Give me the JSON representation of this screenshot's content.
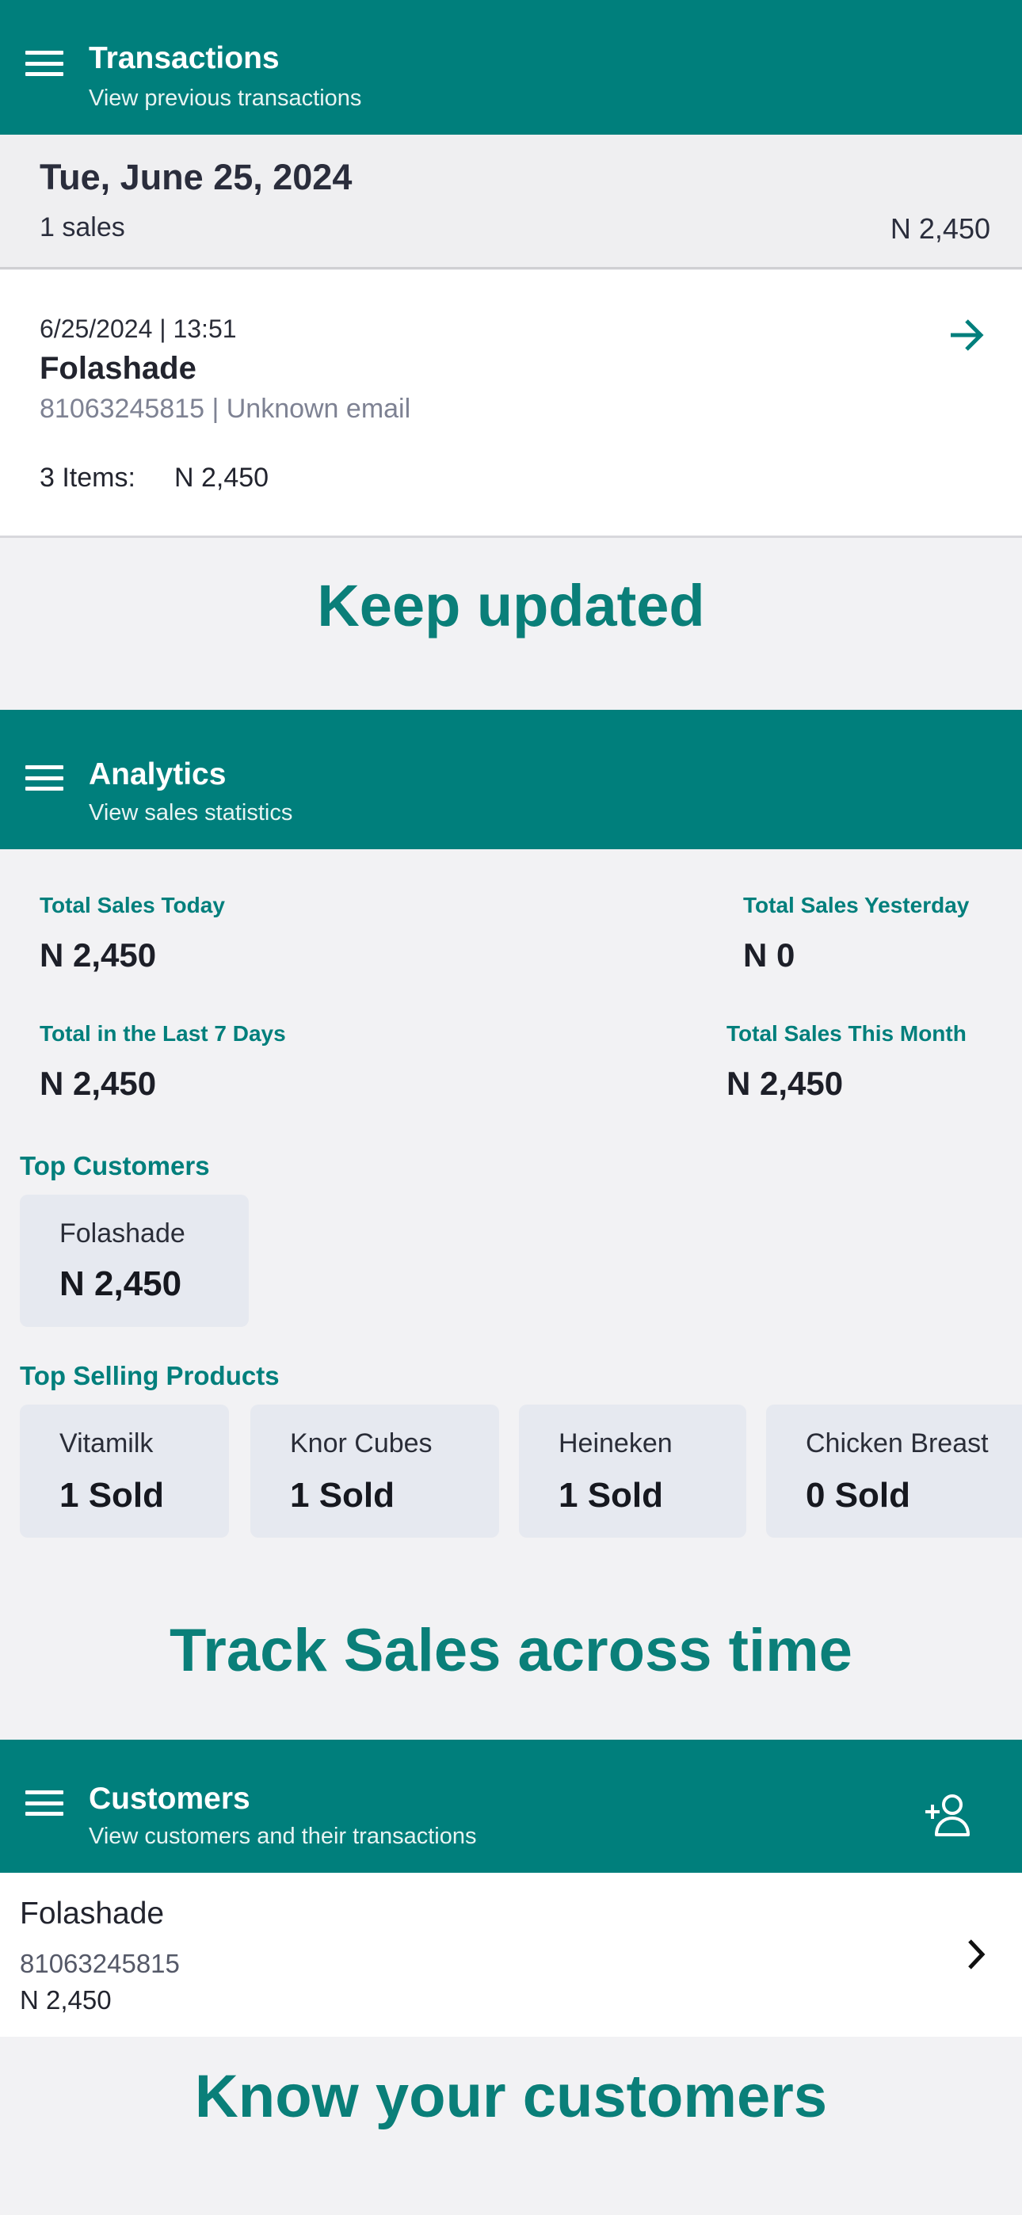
{
  "colors": {
    "accent": "#007f7c",
    "background": "#f2f2f4",
    "card": "#e6e9f0"
  },
  "transactions": {
    "header": {
      "title": "Transactions",
      "subtitle": "View previous transactions",
      "menu_icon": "hamburger-icon"
    },
    "day": {
      "date": "Tue, June 25, 2024",
      "count": "1 sales",
      "total": "N 2,450"
    },
    "items": [
      {
        "datetime": "6/25/2024 | 13:51",
        "customer": "Folashade",
        "contact": "81063245815 | Unknown email",
        "items_label": "3 Items:",
        "amount": "N 2,450",
        "icon": "arrow-right-icon"
      }
    ],
    "tagline": "Keep updated"
  },
  "analytics": {
    "header": {
      "title": "Analytics",
      "subtitle": "View sales statistics",
      "menu_icon": "hamburger-icon"
    },
    "stats": [
      {
        "label": "Total Sales Today",
        "value": "N 2,450"
      },
      {
        "label": "Total Sales Yesterday",
        "value": "N 0"
      },
      {
        "label": "Total in the Last 7 Days",
        "value": "N 2,450"
      },
      {
        "label": "Total Sales This Month",
        "value": "N 2,450"
      }
    ],
    "top_customers_label": "Top Customers",
    "top_customers": [
      {
        "name": "Folashade",
        "amount": "N 2,450"
      }
    ],
    "top_products_label": "Top Selling Products",
    "top_products": [
      {
        "name": "Vitamilk",
        "sold": "1 Sold"
      },
      {
        "name": "Knor Cubes",
        "sold": "1 Sold"
      },
      {
        "name": "Heineken",
        "sold": "1 Sold"
      },
      {
        "name": "Chicken Breast",
        "sold": "0 Sold"
      }
    ],
    "tagline": "Track Sales across time"
  },
  "customers": {
    "header": {
      "title": "Customers",
      "subtitle": "View customers and their transactions",
      "menu_icon": "hamburger-icon",
      "action_icon": "add-person-icon"
    },
    "list": [
      {
        "name": "Folashade",
        "phone": "81063245815",
        "amount": "N 2,450",
        "icon": "chevron-right-icon"
      }
    ],
    "tagline": "Know your customers"
  }
}
